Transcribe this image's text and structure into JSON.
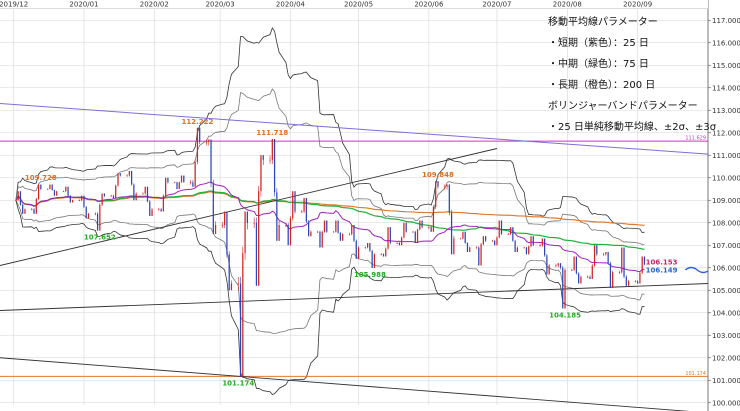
{
  "chart_data": {
    "type": "candlestick",
    "x_ticks": [
      "2019/12",
      "2020/01",
      "2020/02",
      "2020/03",
      "2020/04",
      "2020/05",
      "2020/06",
      "2020/07",
      "2020/08",
      "2020/09"
    ],
    "y_ticks": [
      "100.000",
      "101.000",
      "102.000",
      "103.000",
      "104.000",
      "105.000",
      "106.000",
      "107.000",
      "108.000",
      "109.000",
      "110.000",
      "111.000",
      "112.000",
      "113.000",
      "114.000",
      "115.000",
      "116.000",
      "117.000"
    ],
    "ylim": [
      99.9,
      117.5
    ],
    "grid": true,
    "horizontal_levels": [
      {
        "value": 111.629,
        "label": "111.629",
        "color": "#cc33cc"
      },
      {
        "value": 101.174,
        "label": "101.174",
        "color": "#e07a30"
      }
    ],
    "price_annotations": [
      {
        "label": "112.222",
        "x": "2020/02/20",
        "value": 112.22,
        "color": "#e0701f"
      },
      {
        "label": "111.718",
        "x": "2020/03/24",
        "value": 111.72,
        "color": "#e0701f"
      },
      {
        "label": "109.728",
        "x": "2019/12/13",
        "value": 109.73,
        "color": "#e0701f"
      },
      {
        "label": "109.848",
        "x": "2020/06/05",
        "value": 109.85,
        "color": "#e0701f"
      },
      {
        "label": "107.652",
        "x": "2020/01/08",
        "value": 107.65,
        "color": "#22aa22"
      },
      {
        "label": "105.988",
        "x": "2020/05/06",
        "value": 105.99,
        "color": "#22aa22"
      },
      {
        "label": "104.185",
        "x": "2020/07/31",
        "value": 104.19,
        "color": "#22aa22"
      },
      {
        "label": "101.174",
        "x": "2020/03/09",
        "value": 101.17,
        "color": "#22aa22"
      },
      {
        "label": "106.153",
        "x": "2020/09/01",
        "value": 106.15,
        "color": "#cc2266"
      },
      {
        "label": "106.149",
        "x": "2020/09/01",
        "value": 106.15,
        "color": "#2266cc"
      }
    ],
    "candles": [
      {
        "x": "2019/12/02",
        "o": 109.0,
        "h": 109.4,
        "l": 108.4,
        "c": 108.6
      },
      {
        "x": "2019/12/09",
        "o": 108.6,
        "h": 109.7,
        "l": 108.4,
        "c": 109.5
      },
      {
        "x": "2019/12/16",
        "o": 109.5,
        "h": 109.7,
        "l": 109.2,
        "c": 109.4
      },
      {
        "x": "2019/12/23",
        "o": 109.4,
        "h": 109.6,
        "l": 108.9,
        "c": 109.0
      },
      {
        "x": "2019/12/30",
        "o": 109.0,
        "h": 109.2,
        "l": 108.2,
        "c": 108.4
      },
      {
        "x": "2020/01/06",
        "o": 108.4,
        "h": 109.3,
        "l": 107.65,
        "c": 109.2
      },
      {
        "x": "2020/01/13",
        "o": 109.2,
        "h": 110.2,
        "l": 109.1,
        "c": 110.1
      },
      {
        "x": "2020/01/20",
        "o": 110.1,
        "h": 110.3,
        "l": 109.0,
        "c": 109.3
      },
      {
        "x": "2020/01/27",
        "o": 109.3,
        "h": 109.6,
        "l": 108.3,
        "c": 108.6
      },
      {
        "x": "2020/02/03",
        "o": 108.6,
        "h": 110.0,
        "l": 108.5,
        "c": 109.8
      },
      {
        "x": "2020/02/10",
        "o": 109.8,
        "h": 110.1,
        "l": 109.5,
        "c": 109.8
      },
      {
        "x": "2020/02/17",
        "o": 109.8,
        "h": 112.22,
        "l": 109.6,
        "c": 111.6
      },
      {
        "x": "2020/02/24",
        "o": 111.6,
        "h": 111.7,
        "l": 107.5,
        "c": 107.9
      },
      {
        "x": "2020/03/02",
        "o": 107.9,
        "h": 108.5,
        "l": 105.0,
        "c": 105.3
      },
      {
        "x": "2020/03/09",
        "o": 105.3,
        "h": 108.5,
        "l": 101.17,
        "c": 108.0
      },
      {
        "x": "2020/03/16",
        "o": 108.0,
        "h": 111.0,
        "l": 105.2,
        "c": 110.8
      },
      {
        "x": "2020/03/23",
        "o": 110.8,
        "h": 111.72,
        "l": 107.2,
        "c": 107.9
      },
      {
        "x": "2020/03/30",
        "o": 107.9,
        "h": 109.4,
        "l": 107.0,
        "c": 108.5
      },
      {
        "x": "2020/04/06",
        "o": 108.5,
        "h": 109.1,
        "l": 107.4,
        "c": 107.6
      },
      {
        "x": "2020/04/13",
        "o": 107.6,
        "h": 108.1,
        "l": 106.9,
        "c": 107.6
      },
      {
        "x": "2020/04/20",
        "o": 107.6,
        "h": 108.1,
        "l": 107.2,
        "c": 107.5
      },
      {
        "x": "2020/04/27",
        "o": 107.5,
        "h": 107.9,
        "l": 106.4,
        "c": 106.9
      },
      {
        "x": "2020/05/04",
        "o": 106.9,
        "h": 107.1,
        "l": 105.99,
        "c": 106.6
      },
      {
        "x": "2020/05/11",
        "o": 106.6,
        "h": 107.8,
        "l": 106.5,
        "c": 107.1
      },
      {
        "x": "2020/05/18",
        "o": 107.1,
        "h": 108.0,
        "l": 107.0,
        "c": 107.6
      },
      {
        "x": "2020/05/25",
        "o": 107.6,
        "h": 108.1,
        "l": 107.1,
        "c": 107.8
      },
      {
        "x": "2020/06/01",
        "o": 107.8,
        "h": 109.85,
        "l": 107.6,
        "c": 109.6
      },
      {
        "x": "2020/06/08",
        "o": 109.6,
        "h": 109.7,
        "l": 106.6,
        "c": 107.3
      },
      {
        "x": "2020/06/15",
        "o": 107.3,
        "h": 107.6,
        "l": 106.7,
        "c": 106.9
      },
      {
        "x": "2020/06/22",
        "o": 106.9,
        "h": 107.4,
        "l": 106.1,
        "c": 107.2
      },
      {
        "x": "2020/06/29",
        "o": 107.2,
        "h": 108.1,
        "l": 107.0,
        "c": 107.5
      },
      {
        "x": "2020/07/06",
        "o": 107.5,
        "h": 107.8,
        "l": 106.7,
        "c": 106.9
      },
      {
        "x": "2020/07/13",
        "o": 106.9,
        "h": 107.4,
        "l": 106.6,
        "c": 107.0
      },
      {
        "x": "2020/07/20",
        "o": 107.0,
        "h": 107.3,
        "l": 105.7,
        "c": 106.1
      },
      {
        "x": "2020/07/27",
        "o": 106.1,
        "h": 106.2,
        "l": 104.19,
        "c": 105.9
      },
      {
        "x": "2020/08/03",
        "o": 105.9,
        "h": 106.5,
        "l": 105.3,
        "c": 105.6
      },
      {
        "x": "2020/08/10",
        "o": 105.6,
        "h": 107.0,
        "l": 105.5,
        "c": 106.6
      },
      {
        "x": "2020/08/17",
        "o": 106.6,
        "h": 106.7,
        "l": 105.1,
        "c": 105.8
      },
      {
        "x": "2020/08/24",
        "o": 105.8,
        "h": 106.9,
        "l": 105.2,
        "c": 105.4
      },
      {
        "x": "2020/08/31",
        "o": 105.4,
        "h": 106.5,
        "l": 105.3,
        "c": 106.15
      }
    ],
    "legend_lines": [
      "移動平均線パラメーター",
      "・短期（紫色）：25 日",
      "・中期（緑色）：75 日",
      "・長期（橙色）：200 日",
      "ボリンジャーバンドパラメーター",
      "・25 日単純移動平均線、±2σ、±3σ"
    ],
    "colors": {
      "up": "#d4221e",
      "down": "#2a46b8",
      "ma_short": "#a020c0",
      "ma_mid": "#22b03a",
      "ma_long": "#e07a30",
      "band2": "#777777",
      "band3": "#333333",
      "trend": "#333333",
      "channel": "#7b6fd8",
      "forecast_arrow": "#2a5ee8"
    }
  }
}
